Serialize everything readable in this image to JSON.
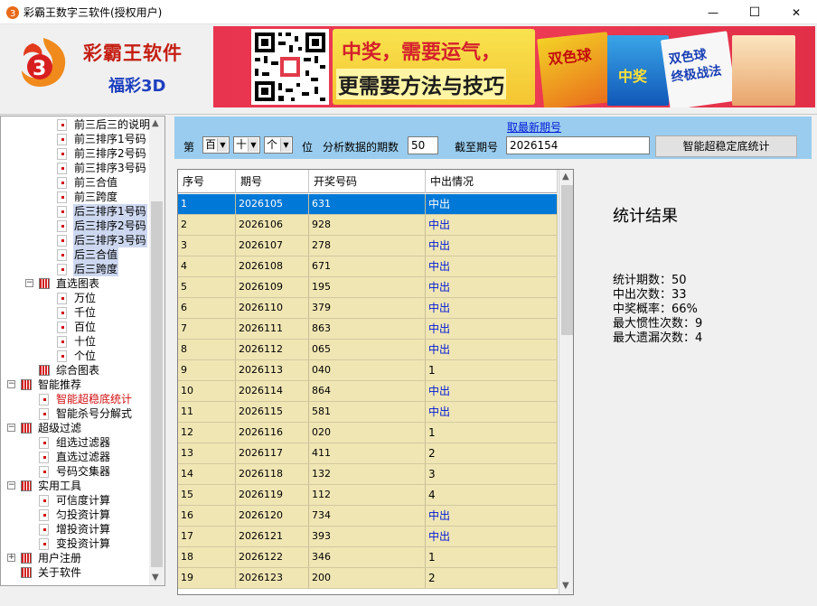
{
  "window": {
    "title": "彩霸王数字三软件(授权用户)",
    "minimize": "—",
    "maximize": "☐",
    "close": "✕"
  },
  "header": {
    "brand": "彩霸王软件",
    "sub_brand": "福彩3D",
    "banner": {
      "slogan_line1": "中奖，需要运气，",
      "slogan_line2": "更需要方法与技巧",
      "book1_label": "双色球",
      "book2_label": "中奖",
      "book3_label": "双色球\n终极战法"
    }
  },
  "tree": {
    "items": [
      {
        "label": "前三后三的说明",
        "level": 3
      },
      {
        "label": "前三排序1号码",
        "level": 3
      },
      {
        "label": "前三排序2号码",
        "level": 3
      },
      {
        "label": "前三排序3号码",
        "level": 3
      },
      {
        "label": "前三合值",
        "level": 3
      },
      {
        "label": "前三跨度",
        "level": 3
      },
      {
        "label": "后三排序1号码",
        "level": 3,
        "selected": true
      },
      {
        "label": "后三排序2号码",
        "level": 3,
        "selected": true
      },
      {
        "label": "后三排序3号码",
        "level": 3,
        "selected": true
      },
      {
        "label": "后三合值",
        "level": 3,
        "selected": true
      },
      {
        "label": "后三跨度",
        "level": 3,
        "selected": true
      },
      {
        "label": "直选图表",
        "level": 2,
        "folder": true,
        "expanded": true
      },
      {
        "label": "万位",
        "level": 3
      },
      {
        "label": "千位",
        "level": 3
      },
      {
        "label": "百位",
        "level": 3
      },
      {
        "label": "十位",
        "level": 3
      },
      {
        "label": "个位",
        "level": 3
      },
      {
        "label": "综合图表",
        "level": 2,
        "folder": true
      },
      {
        "label": "智能推荐",
        "level": 1,
        "folder": true,
        "expanded": true
      },
      {
        "label": "智能超稳底统计",
        "level": 2,
        "active": true
      },
      {
        "label": "智能杀号分解式",
        "level": 2
      },
      {
        "label": "超级过滤",
        "level": 1,
        "folder": true,
        "expanded": true
      },
      {
        "label": "组选过滤器",
        "level": 2
      },
      {
        "label": "直选过滤器",
        "level": 2
      },
      {
        "label": "号码交集器",
        "level": 2
      },
      {
        "label": "实用工具",
        "level": 1,
        "folder": true,
        "expanded": true
      },
      {
        "label": "可信度计算",
        "level": 2
      },
      {
        "label": "匀投资计算",
        "level": 2
      },
      {
        "label": "增投资计算",
        "level": 2
      },
      {
        "label": "变投资计算",
        "level": 2
      },
      {
        "label": "用户注册",
        "level": 1,
        "folder": true,
        "collapsed": true
      },
      {
        "label": "关于软件",
        "level": 1,
        "folder": true
      }
    ]
  },
  "controls": {
    "latest_link": "取最新期号",
    "label_di": "第",
    "pos1": "百",
    "pos2": "十",
    "pos3": "个",
    "label_wei": "位",
    "label_periods": "分析数据的期数",
    "periods_value": "50",
    "label_until": "截至期号",
    "until_value": "2026154",
    "run_button": "智能超稳定底统计"
  },
  "grid": {
    "columns": [
      "序号",
      "期号",
      "开奖号码",
      "中出情况"
    ],
    "rows": [
      [
        "1",
        "2026105",
        "631",
        "中出"
      ],
      [
        "2",
        "2026106",
        "928",
        "中出"
      ],
      [
        "3",
        "2026107",
        "278",
        "中出"
      ],
      [
        "4",
        "2026108",
        "671",
        "中出"
      ],
      [
        "5",
        "2026109",
        "195",
        "中出"
      ],
      [
        "6",
        "2026110",
        "379",
        "中出"
      ],
      [
        "7",
        "2026111",
        "863",
        "中出"
      ],
      [
        "8",
        "2026112",
        "065",
        "中出"
      ],
      [
        "9",
        "2026113",
        "040",
        "1"
      ],
      [
        "10",
        "2026114",
        "864",
        "中出"
      ],
      [
        "11",
        "2026115",
        "581",
        "中出"
      ],
      [
        "12",
        "2026116",
        "020",
        "1"
      ],
      [
        "13",
        "2026117",
        "411",
        "2"
      ],
      [
        "14",
        "2026118",
        "132",
        "3"
      ],
      [
        "15",
        "2026119",
        "112",
        "4"
      ],
      [
        "16",
        "2026120",
        "734",
        "中出"
      ],
      [
        "17",
        "2026121",
        "393",
        "中出"
      ],
      [
        "18",
        "2026122",
        "346",
        "1"
      ],
      [
        "19",
        "2026123",
        "200",
        "2"
      ]
    ]
  },
  "results": {
    "title": "统计结果",
    "lines": [
      "统计期数：50",
      "中出次数：33",
      "中奖概率：66%",
      "最大惯性次数：9",
      "最大遗漏次数：4"
    ]
  }
}
